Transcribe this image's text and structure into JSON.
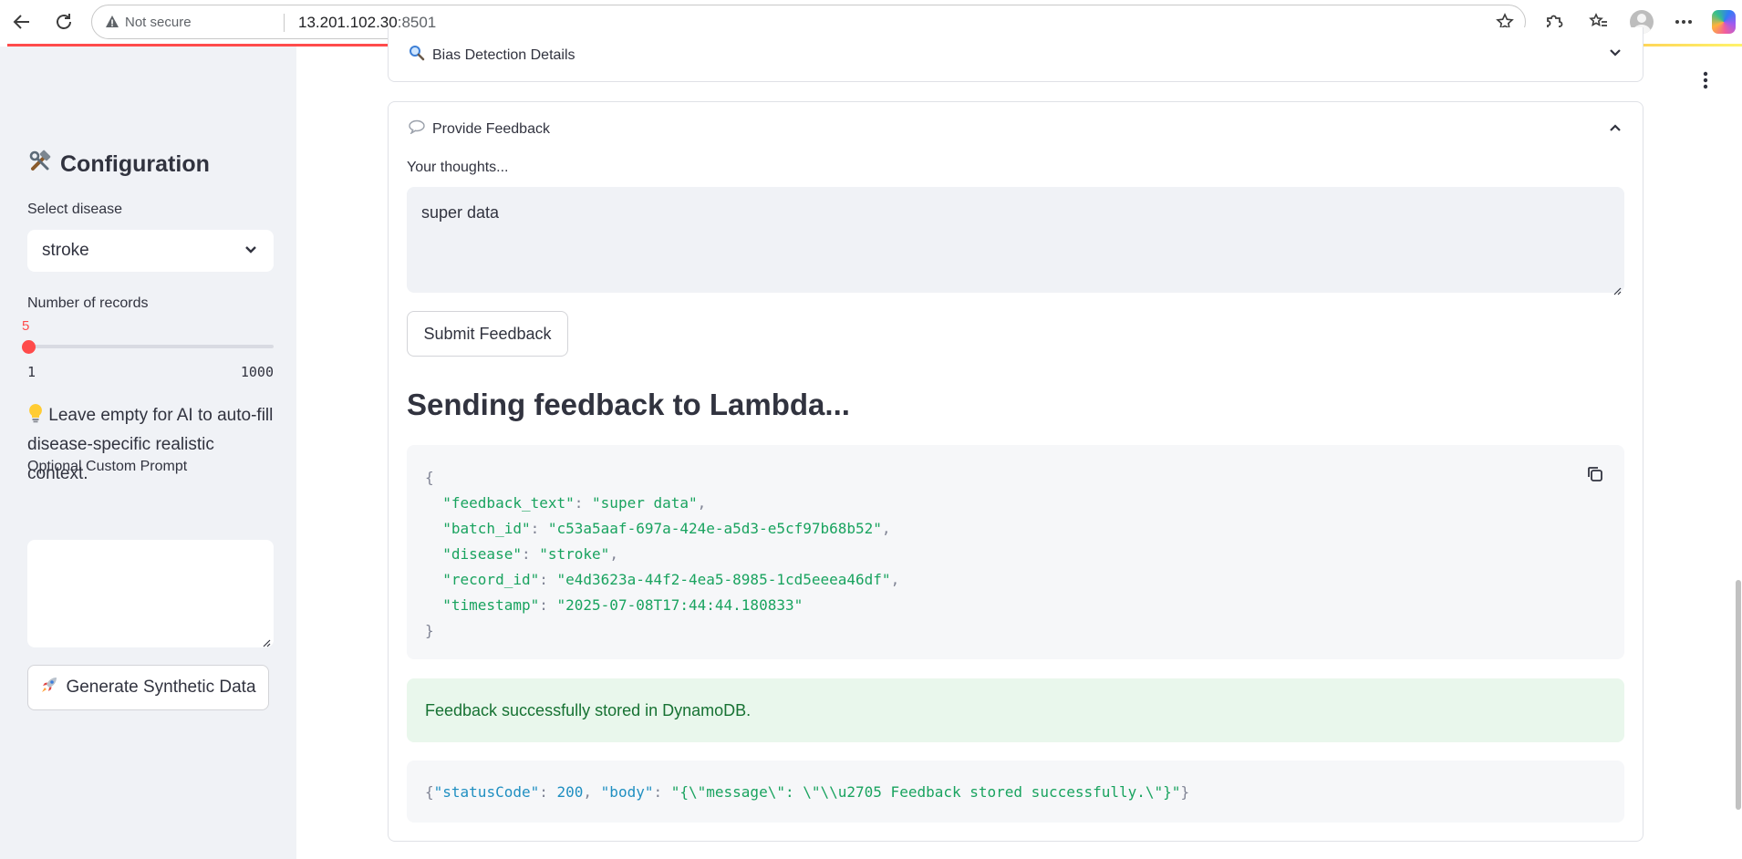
{
  "browser": {
    "security_label": "Not secure",
    "url_host": "13.201.102.30",
    "url_port": ":8501"
  },
  "sidebar": {
    "title": "Configuration",
    "title_icon": "hammer-wrench-icon",
    "disease_label": "Select disease",
    "disease_value": "stroke",
    "records_label": "Number of records",
    "records_value": "5",
    "records_min": "1",
    "records_max": "1000",
    "tip_icon": "lightbulb-icon",
    "tip_text": "Leave empty for AI to auto-fill disease-specific realistic context.",
    "custom_prompt_label": "Optional Custom Prompt",
    "custom_prompt_value": "",
    "generate_icon": "rocket-icon",
    "generate_label": "Generate Synthetic Data"
  },
  "main": {
    "bias_expander": {
      "icon": "magnifier-icon",
      "label": "Bias Detection Details",
      "expanded": false
    },
    "feedback_expander": {
      "icon": "speech-bubble-icon",
      "label": "Provide Feedback",
      "expanded": true
    },
    "thoughts_label": "Your thoughts...",
    "thoughts_value": "super data",
    "submit_label": "Submit Feedback",
    "heading": "Sending feedback to Lambda...",
    "payload": {
      "feedback_text": "super data",
      "batch_id": "c53a5aaf-697a-424e-a5d3-e5cf97b68b52",
      "disease": "stroke",
      "record_id": "e4d3623a-44f2-4ea5-8985-1cd5eeea46df",
      "timestamp": "2025-07-08T17:44:44.180833"
    },
    "success_message": "Feedback successfully stored in DynamoDB.",
    "response": {
      "status_key": "\"statusCode\"",
      "status_value": "200",
      "body_key": "\"body\"",
      "body_value": "\"{\\\"message\\\": \\\"\\\\u2705 Feedback stored successfully.\\\"}\""
    }
  },
  "colors": {
    "accent": "#ff4b4b",
    "sidebar_bg": "#f0f2f6",
    "success_bg": "#e9f7ec",
    "success_text": "#177233",
    "code_string": "#19a35f",
    "code_key_blue": "#1f8fc1"
  }
}
